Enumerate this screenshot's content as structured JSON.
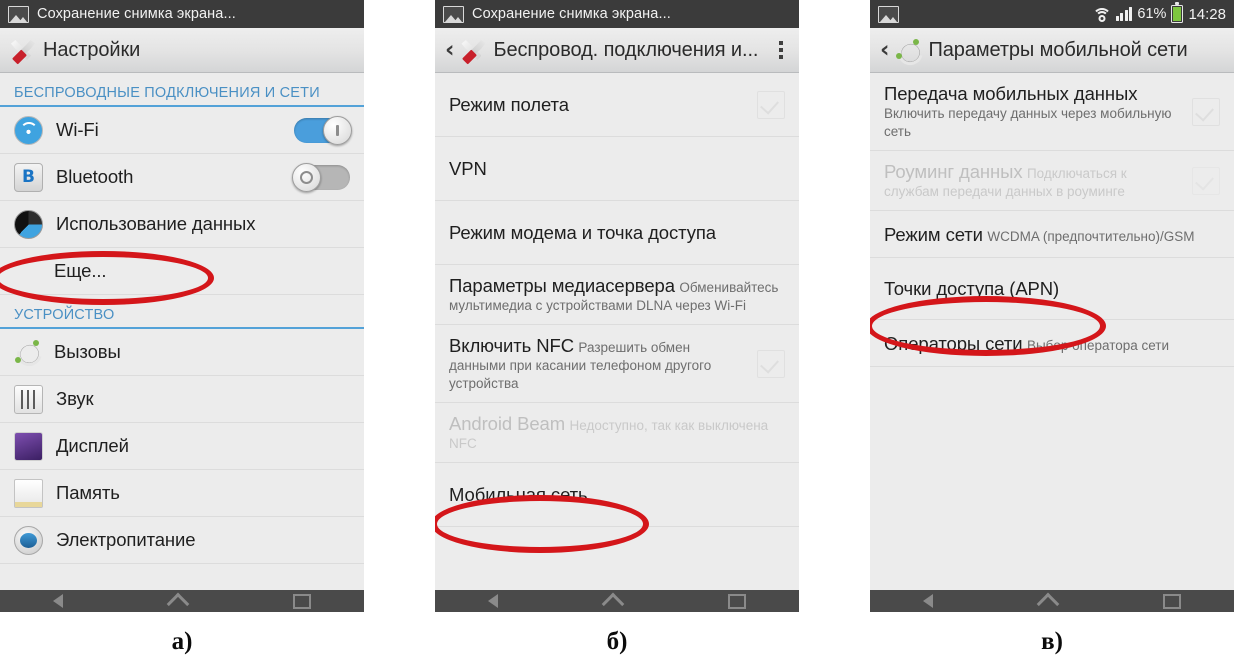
{
  "figure": {
    "captions": [
      "а)",
      "б)",
      "в)"
    ],
    "annotation_color": "#d4161a"
  },
  "panels": [
    {
      "statusbar": {
        "icon": "image-icon",
        "title": "Сохранение снимка экрана..."
      },
      "actionbar": {
        "icon": "settings-tools-icon",
        "title": "Настройки"
      },
      "section_header": "БЕСПРОВОДНЫЕ ПОДКЛЮЧЕНИЯ И СЕТИ",
      "section_header_2": "УСТРОЙСТВО",
      "rows": [
        {
          "title": "Wi-Fi",
          "icon": "wifi-icon",
          "control": "toggle",
          "state": "on"
        },
        {
          "title": "Bluetooth",
          "icon": "bluetooth-icon",
          "control": "toggle",
          "state": "off"
        },
        {
          "title": "Использование данных",
          "icon": "data-usage-icon",
          "control": "none"
        },
        {
          "title": "Еще...",
          "icon": "none",
          "control": "none",
          "highlighted": true
        },
        {
          "title": "Вызовы",
          "icon": "calls-icon",
          "control": "none"
        },
        {
          "title": "Звук",
          "icon": "sound-icon",
          "control": "none"
        },
        {
          "title": "Дисплей",
          "icon": "display-icon",
          "control": "none"
        },
        {
          "title": "Память",
          "icon": "storage-icon",
          "control": "none"
        },
        {
          "title": "Электропитание",
          "icon": "power-icon",
          "control": "none"
        }
      ]
    },
    {
      "statusbar": {
        "icon": "image-icon",
        "title": "Сохранение снимка экрана..."
      },
      "actionbar": {
        "icon": "settings-tools-icon",
        "title": "Беспровод. подключения и...",
        "back": "‹",
        "overflow": "overflow-menu-icon"
      },
      "rows": [
        {
          "title": "Режим полета",
          "sub": "",
          "control": "checkbox"
        },
        {
          "title": "VPN",
          "sub": "",
          "control": "none"
        },
        {
          "title": "Режим модема и точка доступа",
          "sub": "",
          "control": "none"
        },
        {
          "title": "Параметры медиасервера",
          "sub": "Обменивайтесь мультимедиа с устройствами DLNA через Wi-Fi",
          "control": "none"
        },
        {
          "title": "Включить NFC",
          "sub": "Разрешить обмен данными при касании телефоном другого устройства",
          "control": "checkbox"
        },
        {
          "title": "Android Beam",
          "sub": "Недоступно, так как выключена NFC",
          "control": "none",
          "disabled": true
        },
        {
          "title": "Мобильная сеть",
          "sub": "",
          "control": "none",
          "highlighted": true
        }
      ]
    },
    {
      "statusbar": {
        "icon": "image-icon",
        "wifi": "wifi-status-icon",
        "signal": "signal-bars-icon",
        "battery_percent": "61%",
        "battery": "battery-icon",
        "clock": "14:28"
      },
      "actionbar": {
        "icon": "calls-phone-icon",
        "title": "Параметры мобильной сети",
        "back": "‹"
      },
      "rows": [
        {
          "title": "Передача мобильных данных",
          "sub": "Включить передачу данных через мобильную сеть",
          "control": "checkbox"
        },
        {
          "title": "Роуминг данных",
          "sub": "Подключаться к службам передачи данных в роуминге",
          "control": "checkbox",
          "disabled": true
        },
        {
          "title": "Режим сети",
          "sub": "WCDMA (предпочтительно)/GSM",
          "control": "none"
        },
        {
          "title": "Точки доступа (APN)",
          "sub": "",
          "control": "none",
          "highlighted": true
        },
        {
          "title": "Операторы сети",
          "sub": "Выбор оператора сети",
          "control": "none"
        }
      ]
    }
  ],
  "navbar": {
    "back": "nav-back-icon",
    "home": "nav-home-icon",
    "recent": "nav-recent-apps-icon"
  }
}
